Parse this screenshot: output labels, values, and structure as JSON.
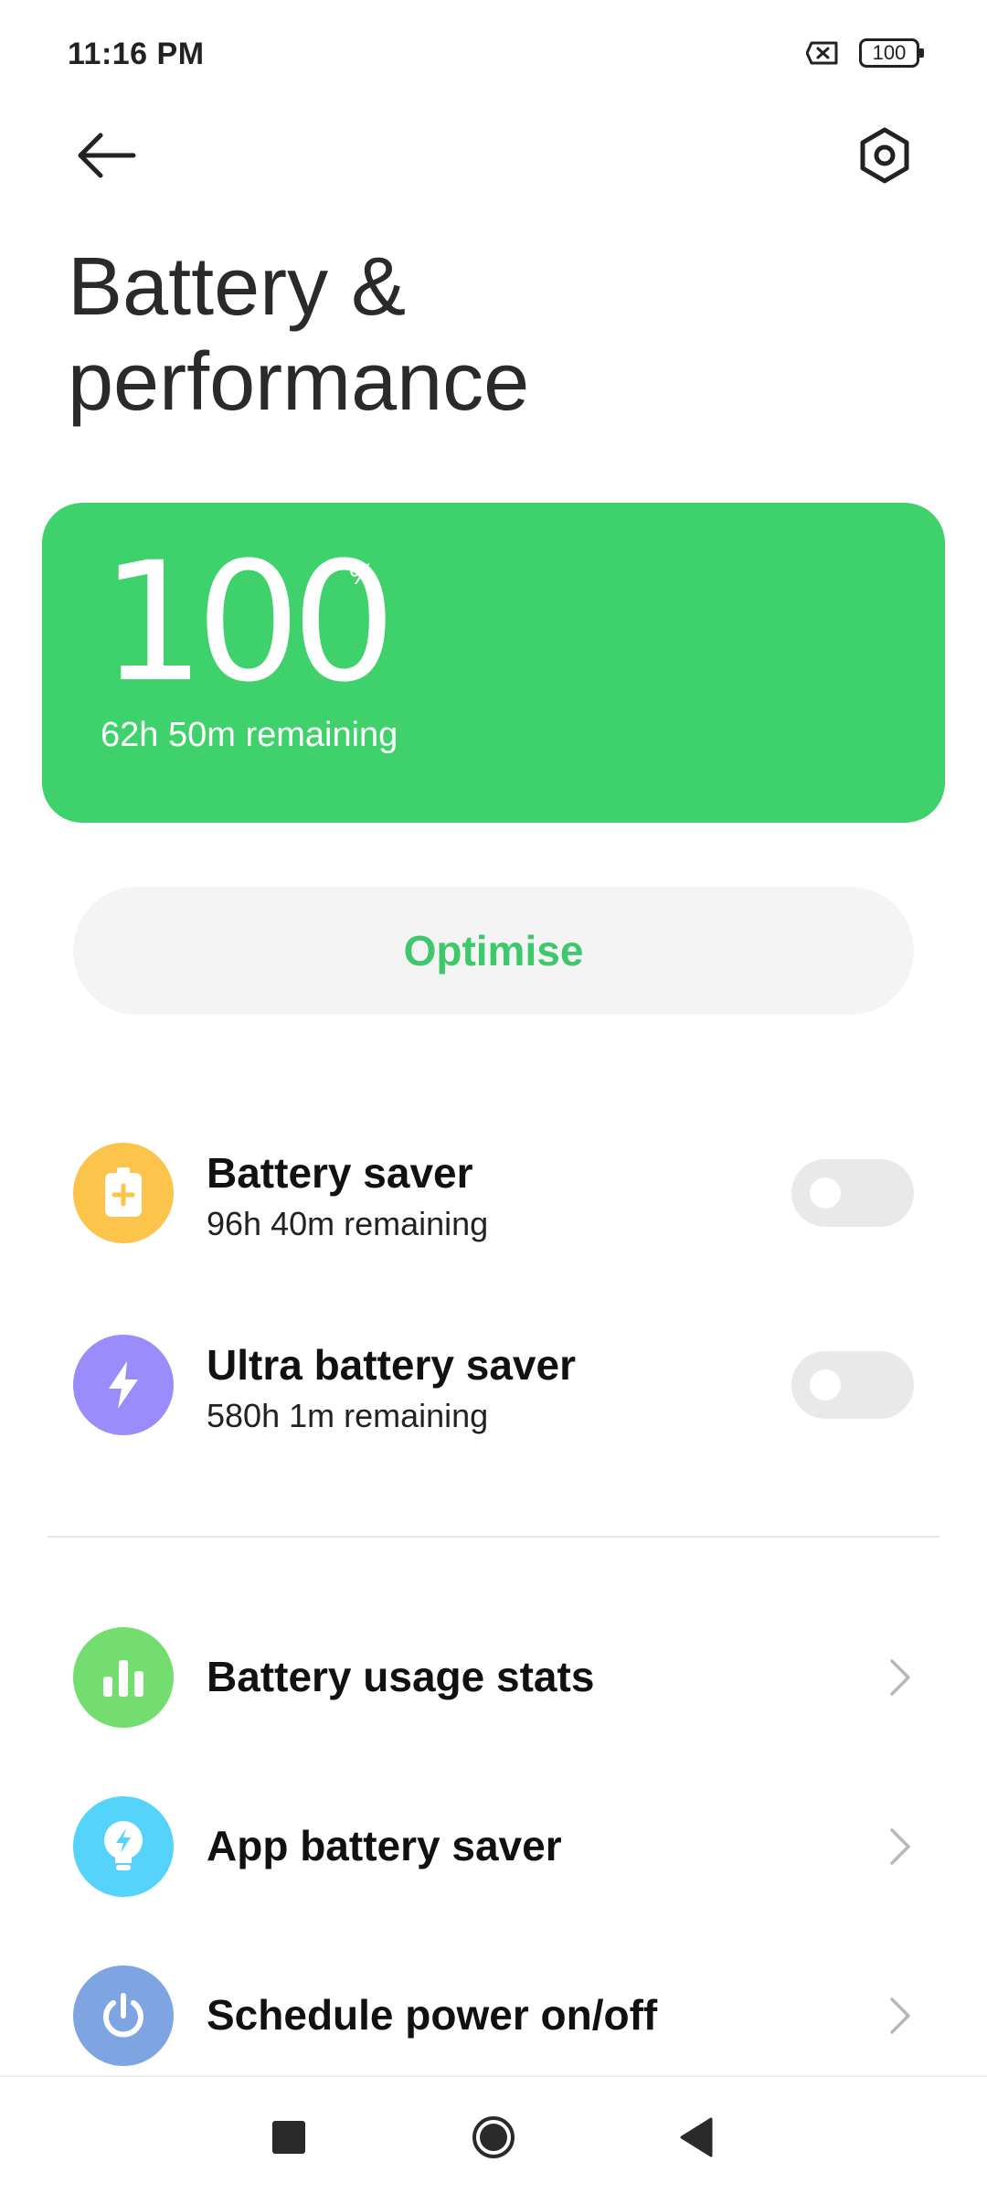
{
  "status_bar": {
    "time": "11:16 PM",
    "battery_level": "100",
    "icons": [
      "no-sim-icon",
      "battery-icon"
    ]
  },
  "header": {
    "title": "Battery & performance",
    "icons": [
      "back-arrow-icon",
      "settings-icon"
    ]
  },
  "battery_card": {
    "level": "100",
    "unit": "%",
    "remaining": "62h 50m remaining",
    "color": "#3fd16b"
  },
  "optimise_button": {
    "label": "Optimise",
    "color": "#3fc76b"
  },
  "toggles": [
    {
      "title": "Battery saver",
      "subtitle": "96h 40m remaining",
      "enabled": false,
      "icon": "battery-plus-icon",
      "icon_color": "#fcc44a"
    },
    {
      "title": "Ultra battery saver",
      "subtitle": "580h 1m remaining",
      "enabled": false,
      "icon": "lightning-icon",
      "icon_color": "#9a8cfb"
    }
  ],
  "menu_items": [
    {
      "title": "Battery usage stats",
      "icon": "bar-chart-icon",
      "icon_color": "#74dd6f"
    },
    {
      "title": "App battery saver",
      "icon": "bulb-bolt-icon",
      "icon_color": "#56d3fb"
    },
    {
      "title": "Schedule power on/off",
      "icon": "power-icon",
      "icon_color": "#7ea5e2"
    }
  ],
  "navigation_bar": {
    "icons": [
      "recent-apps-icon",
      "home-icon",
      "back-icon"
    ]
  }
}
